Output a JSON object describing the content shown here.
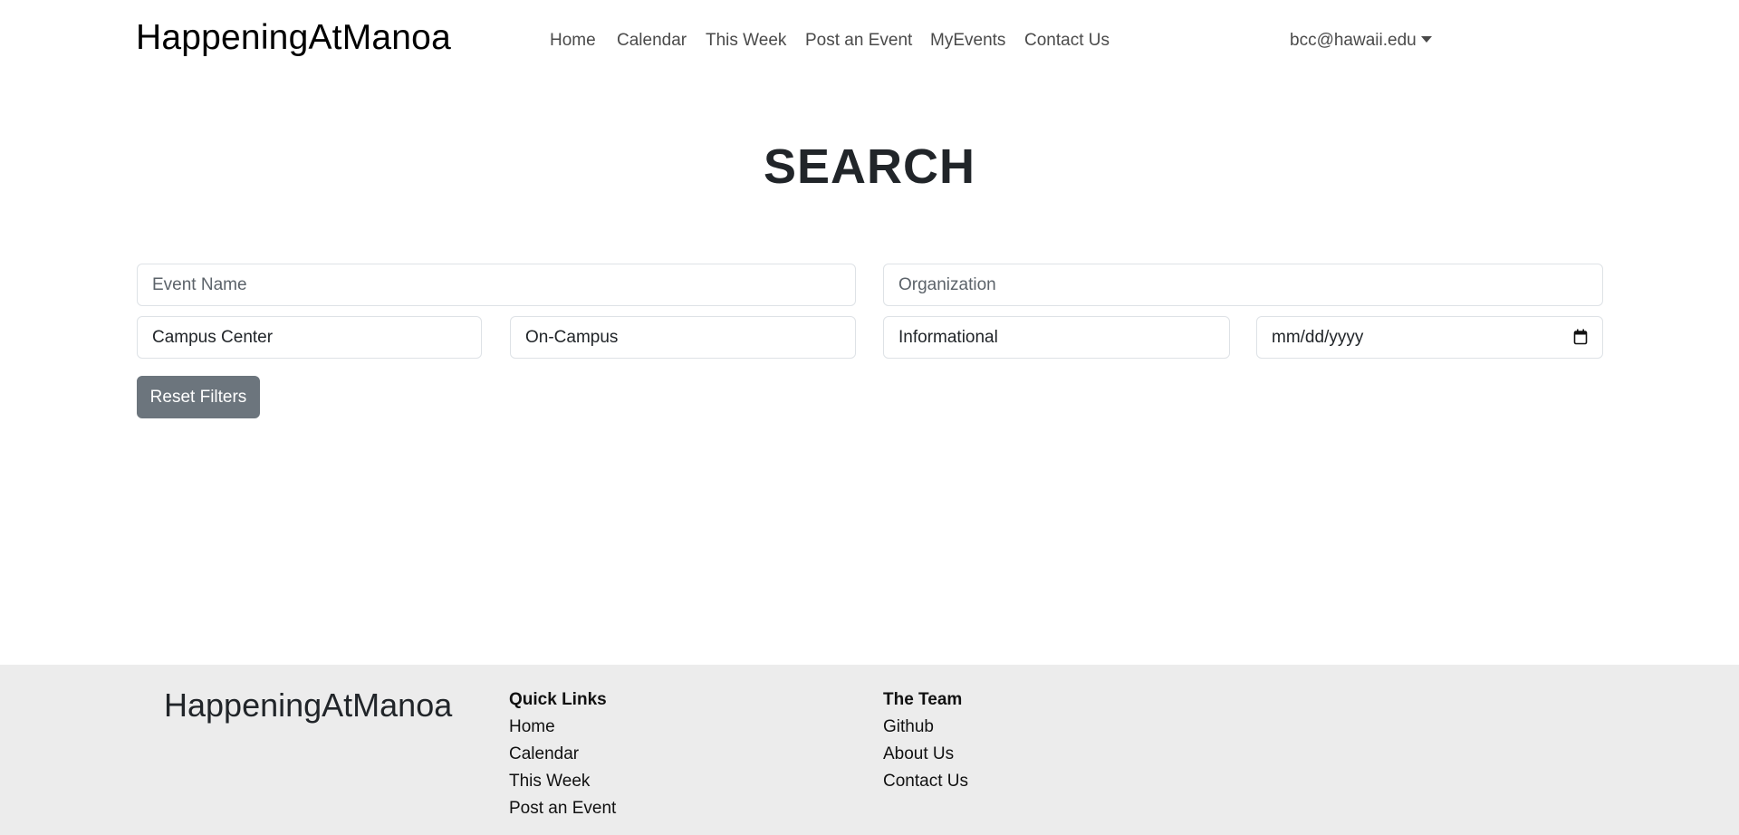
{
  "header": {
    "brand": "HappeningAtManoa",
    "nav": [
      {
        "label": "Home"
      },
      {
        "label": "Calendar"
      },
      {
        "label": "This Week"
      },
      {
        "label": "Post an Event"
      },
      {
        "label": "MyEvents"
      },
      {
        "label": "Contact Us"
      }
    ],
    "user": {
      "email": "bcc@hawaii.edu",
      "icon": "caret-down-icon"
    }
  },
  "main": {
    "title": "SEARCH",
    "filters": {
      "event_name": {
        "value": "",
        "placeholder": "Event Name"
      },
      "organization": {
        "value": "",
        "placeholder": "Organization"
      },
      "location": {
        "value": "Campus Center"
      },
      "campus": {
        "value": "On-Campus"
      },
      "category": {
        "value": "Informational"
      },
      "date": {
        "value": "",
        "placeholder": "mm/dd/yyyy",
        "icon": "calendar-icon"
      }
    },
    "reset_label": "Reset Filters"
  },
  "footer": {
    "brand": "HappeningAtManoa",
    "quick_links": {
      "heading": "Quick Links",
      "items": [
        {
          "label": "Home"
        },
        {
          "label": "Calendar"
        },
        {
          "label": "This Week"
        },
        {
          "label": "Post an Event"
        }
      ]
    },
    "team": {
      "heading": "The Team",
      "items": [
        {
          "label": "Github"
        },
        {
          "label": "About Us"
        },
        {
          "label": "Contact Us"
        }
      ]
    }
  },
  "colors": {
    "footer_bg": "#ececec",
    "reset_button": "#6c757d",
    "input_border": "#dee2e6"
  }
}
